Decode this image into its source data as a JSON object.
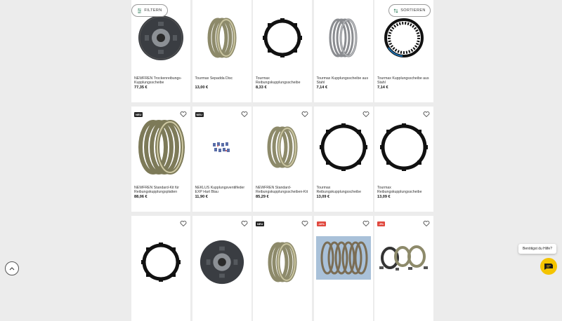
{
  "toolbar": {
    "filter_label": "FILTERN",
    "sort_label": "SORTIEREN"
  },
  "help": {
    "bubble_text": "Benötigst du Hilfe?"
  },
  "products": [
    {
      "title": "NEWFREN Trockenreibungs-Kupplungsscheibe",
      "price": "77,35 €",
      "badge": "",
      "image": "clutch-plate"
    },
    {
      "title": "Tourmax Sepadda Disc",
      "price": "13,00 €",
      "badge": "",
      "image": "friction-stack"
    },
    {
      "title": "Tourmax Reibungskupplungsscheibe",
      "price": "8,33 €",
      "badge": "",
      "image": "black-ring"
    },
    {
      "title": "Tourmax Kupplungsscheibe aus Stahl",
      "price": "7,14 €",
      "badge": "",
      "image": "steel-stack"
    },
    {
      "title": "Tourmax Kupplungsscheibe aus Stahl",
      "price": "7,14 €",
      "badge": "",
      "image": "toothed-ring"
    },
    {
      "title": "NEWFREN Standard-Kit für Reibungskupplungsplatten",
      "price": "88,06 €",
      "badge": "NEU",
      "image": "friction-stack-large"
    },
    {
      "title": "NEKLUS Kupplungsventilfeder EXP Hart Blau",
      "price": "11,90 €",
      "badge": "NEU",
      "image": "spring-set"
    },
    {
      "title": "NEWFREN Standard-Reibungskupplungsscheiben-Kit",
      "price": "85,29 €",
      "badge": "",
      "image": "friction-stack"
    },
    {
      "title": "Tourmax Reibungskupplungsscheibe",
      "price": "13,09 €",
      "badge": "",
      "image": "black-ring-large"
    },
    {
      "title": "Tourmax Reibungskupplungsscheibe",
      "price": "13,09 €",
      "badge": "",
      "image": "black-ring-large"
    },
    {
      "title": "",
      "price": "",
      "badge": "",
      "image": "black-ring"
    },
    {
      "title": "",
      "price": "",
      "badge": "",
      "image": "clutch-plate"
    },
    {
      "title": "",
      "price": "",
      "badge": "NEU",
      "image": "friction-stack"
    },
    {
      "title": "",
      "price": "",
      "badge": "-10%",
      "image": "photo-kit"
    },
    {
      "title": "",
      "price": "",
      "badge": "-9%",
      "image": "parts-kit"
    }
  ]
}
